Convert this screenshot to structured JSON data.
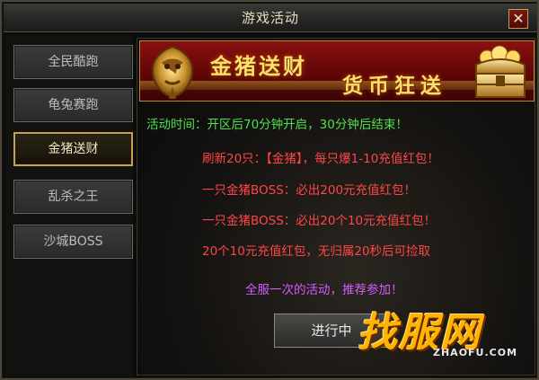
{
  "window": {
    "title": "游戏活动"
  },
  "sidebar": {
    "items": [
      {
        "label": "全民酷跑",
        "active": false
      },
      {
        "label": "龟兔赛跑",
        "active": false
      },
      {
        "label": "金猪送财",
        "active": true
      },
      {
        "label": "乱杀之王",
        "active": false
      },
      {
        "label": "沙城BOSS",
        "active": false
      }
    ]
  },
  "banner": {
    "title_left": "金猪送财",
    "title_right": "货币狂送"
  },
  "content": {
    "time_line": "活动时间：开区后70分钟开启，30分钟后结束！",
    "red_lines": [
      "刷新20只：【金猪】，每只爆1-10充值红包！",
      "一只金猪BOSS：必出200元充值红包！",
      "一只金猪BOSS：必出20个10元充值红包！",
      "20个10元充值红包，无归属20秒后可捡取"
    ],
    "purple_line": "全服一次的活动，推荐参加！"
  },
  "action_button": {
    "label": "进行中"
  },
  "watermark": {
    "brand": "找服网",
    "url": "ZHAOFU.COM"
  },
  "colors": {
    "green_text": "#4fe04f",
    "red_text": "#ff4646",
    "purple_text": "#d45bff",
    "gold_accent": "#c8a148",
    "banner_red": "#8a1010"
  },
  "icons": [
    "close-icon",
    "golden-dragon-emblem",
    "treasure-chest-icon"
  ]
}
